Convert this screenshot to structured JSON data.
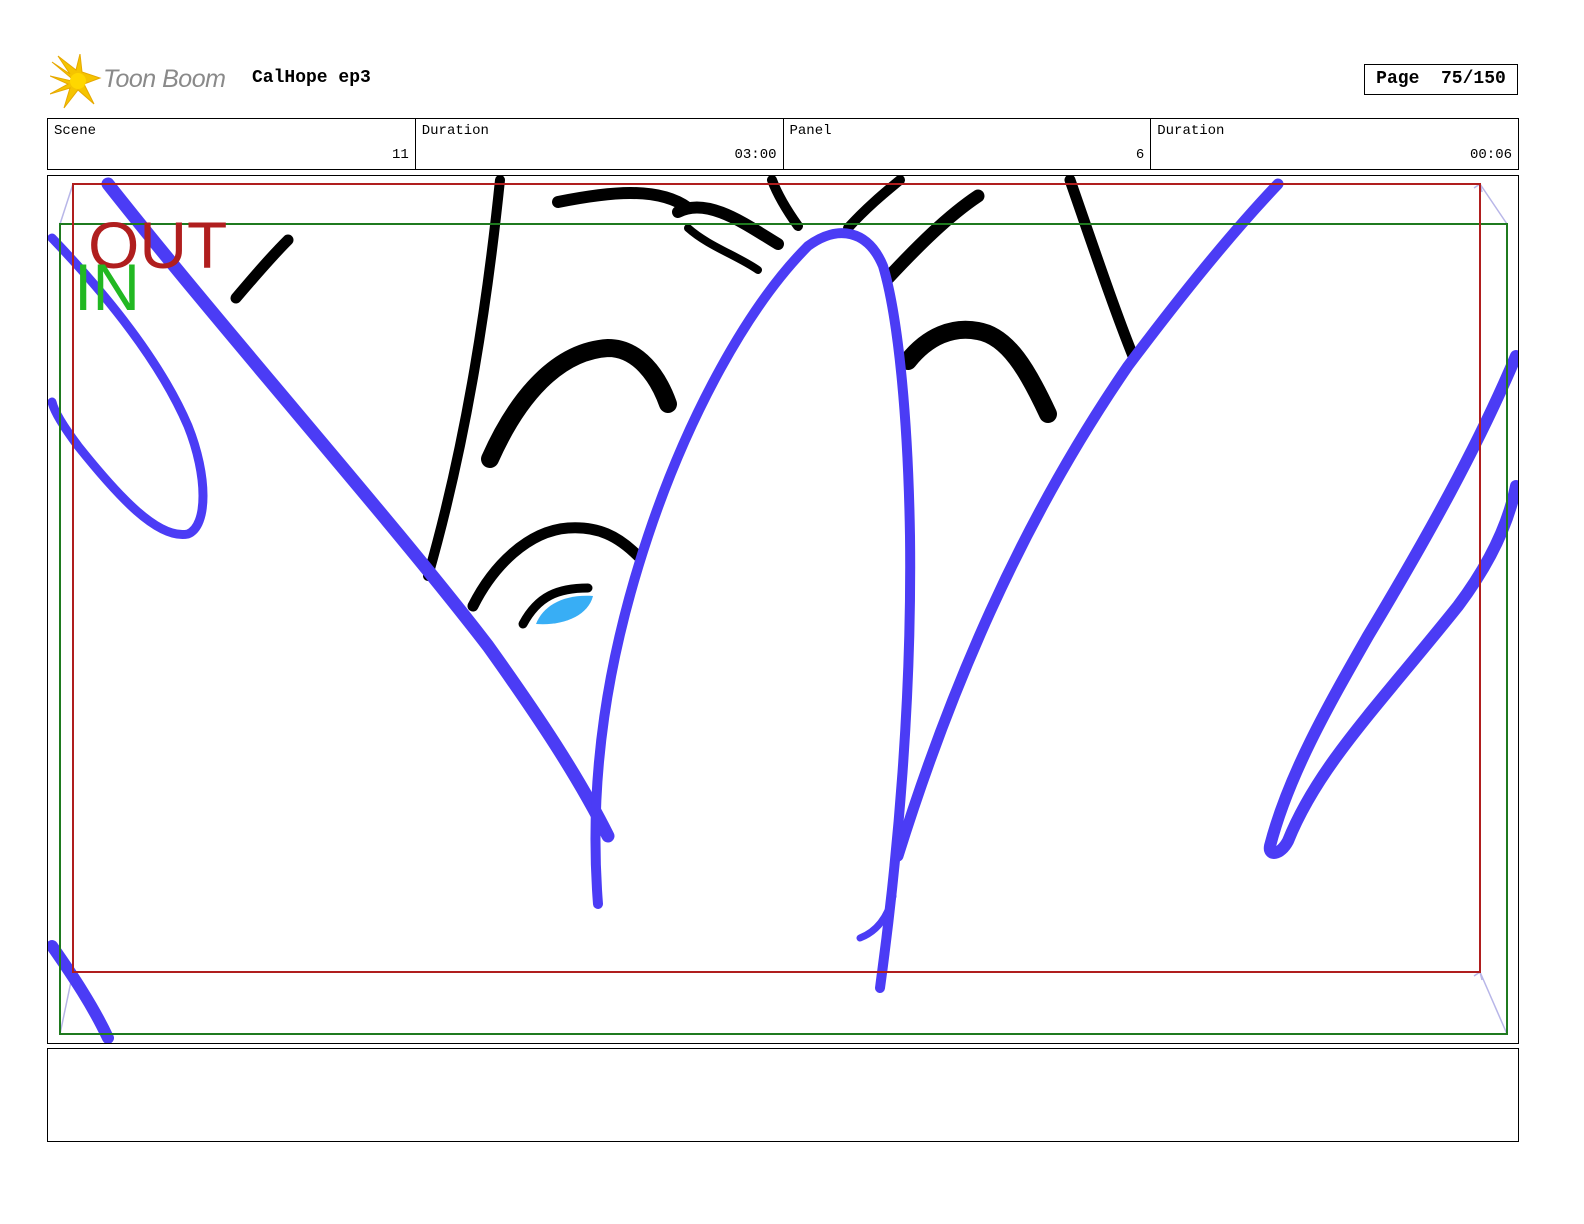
{
  "header": {
    "logo_text": "Toon Boom",
    "project_title": "CalHope ep3",
    "page_label": "Page",
    "page_value": "75/150"
  },
  "info": [
    {
      "label": "Scene",
      "value": "11"
    },
    {
      "label": "Duration",
      "value": "03:00"
    },
    {
      "label": "Panel",
      "value": "6"
    },
    {
      "label": "Duration",
      "value": "00:06"
    }
  ],
  "panel": {
    "out_label": "OUT",
    "in_label": "IN",
    "colors": {
      "out_frame": "#b01e1e",
      "in_frame": "#1f7a1f",
      "in_text": "#22b822",
      "stroke_blue": "#4b3cf5",
      "eye_blue": "#38aef5"
    }
  },
  "notes": {
    "text": ""
  }
}
